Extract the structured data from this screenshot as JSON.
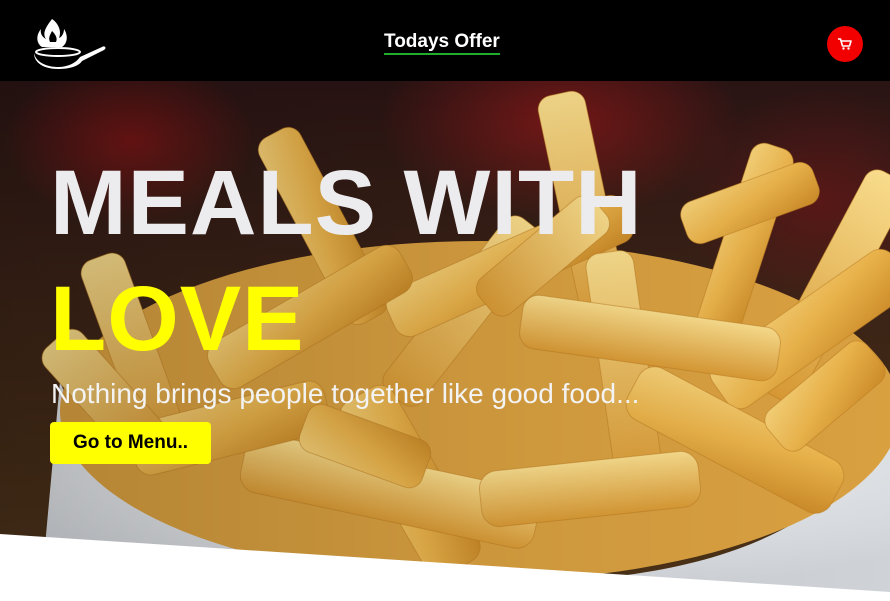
{
  "navbar": {
    "logo_icon": "chef-pan-flame-icon",
    "link_label": "Todays Offer",
    "link_underline_color": "#1fae2c",
    "cart_icon": "cart-icon",
    "cart_color": "#f20000"
  },
  "hero": {
    "headline_line1": "MEALS WITH",
    "headline_line2": "LOVE",
    "headline_line2_color": "#ffff00",
    "tagline": "Nothing brings people together like good food...",
    "cta_label": "Go to Menu..",
    "cta_color": "#ffff00",
    "background_image": "french-fries-bowl-photo"
  }
}
